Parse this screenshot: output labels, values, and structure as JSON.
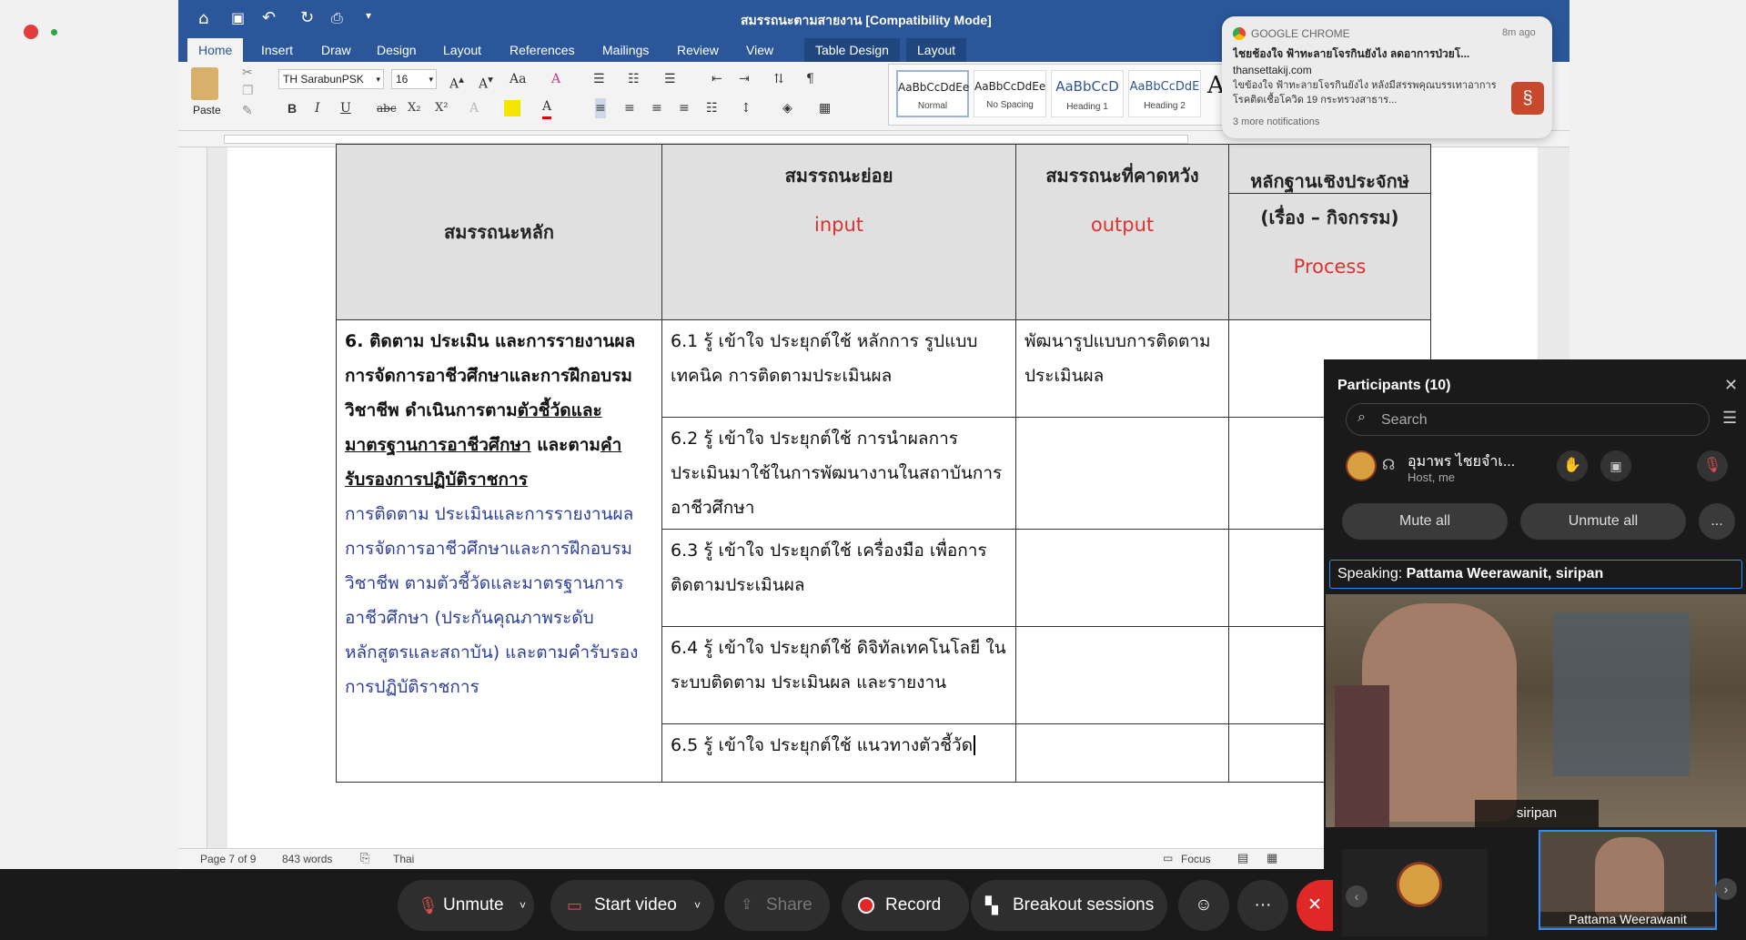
{
  "window": {
    "title": "สมรรถนะตามสายงาน [Compatibility Mode]"
  },
  "ribbon": {
    "tabs": [
      "Home",
      "Insert",
      "Draw",
      "Design",
      "Layout",
      "References",
      "Mailings",
      "Review",
      "View",
      "Table Design",
      "Layout"
    ],
    "active_tab": "Home",
    "font_name": "TH SarabunPSK",
    "font_size": "16",
    "paste_label": "Paste",
    "styles": [
      {
        "preview": "AaBbCcDdEe",
        "name": "Normal"
      },
      {
        "preview": "AaBbCcDdEe",
        "name": "No Spacing"
      },
      {
        "preview": "AaBbCcD",
        "name": "Heading 1"
      },
      {
        "preview": "AaBbCcDdE",
        "name": "Heading 2"
      }
    ]
  },
  "document": {
    "header": {
      "col1": "สมรรถนะหลัก",
      "col2": "สมรรถนะย่อย",
      "col2_sub": "input",
      "col3": "สมรรถนะที่คาดหวัง",
      "col3_sub": "output",
      "col4_top": "หลักฐานเชิงประจักษ์",
      "col4": "(เรื่อง – กิจกรรม)",
      "col4_sub": "Process"
    },
    "main_competency": {
      "num": "6. ",
      "p1": "ติดตาม ประเมิน และการรายงานผลการจัดการอาชีวศึกษาและการฝึกอบรมวิชาชีพ ดำเนินการตาม",
      "u1": "ตัวชี้วัดและมาตรฐานการอาชีวศึกษา",
      "p2": " และตาม",
      "u2": "คำรับรองการปฏิบัติราชการ",
      "desc": "การติดตาม ประเมินและการรายงานผลการจัดการอาชีวศึกษาและการฝึกอบรมวิชาชีพ ตามตัวชี้วัดและมาตรฐานการอาชีวศึกษา (ประกันคุณภาพระดับหลักสูตรและสถาบัน) และตามคำรับรองการปฏิบัติราชการ"
    },
    "rows": [
      {
        "sub": "6.1 รู้ เข้าใจ ประยุกต์ใช้ หลักการ รูปแบบ เทคนิค การติดตามประเมินผล",
        "output": "พัฒนารูปแบบการติดตามประเมินผล"
      },
      {
        "sub": "6.2 รู้ เข้าใจ ประยุกต์ใช้ การนำผลการประเมินมาใช้ในการพัฒนางานในสถาบันการอาชีวศึกษา",
        "output": ""
      },
      {
        "sub": "6.3 รู้ เข้าใจ ประยุกต์ใช้ เครื่องมือ เพื่อการติดตามประเมินผล",
        "output": ""
      },
      {
        "sub": "6.4 รู้ เข้าใจ ประยุกต์ใช้ ดิจิทัลเทคโนโลยี ในระบบติดตาม ประเมินผล และรายงาน",
        "output": ""
      },
      {
        "sub": "6.5 รู้ เข้าใจ ประยุกต์ใช้ แนวทางตัวชี้วัด",
        "output": ""
      }
    ]
  },
  "statusbar": {
    "page": "Page 7 of 9",
    "words": "843 words",
    "language": "Thai",
    "focus": "Focus"
  },
  "notification": {
    "app": "GOOGLE CHROME",
    "time": "8m ago",
    "title": "ไชยช้องใจ ฟ้าทะลายโจรกินยังไง ลดอาการป่วยโ...",
    "site": "thansettakij.com",
    "body": "ไขข้องใจ ฟ้าทะลายโจรกินยังไง หลังมีสรรพคุณบรรเทาอาการโรคติดเชื้อโควิด 19 กระทรวงสาธาร...",
    "more": "3 more notifications"
  },
  "participants": {
    "title": "Participants (10)",
    "search_placeholder": "Search",
    "host_name": "อุมาพร ไชยจำเ...",
    "host_role": "Host, me",
    "mute_all": "Mute all",
    "unmute_all": "Unmute all",
    "more": "..."
  },
  "speaking": {
    "label": "Speaking: ",
    "names": "Pattama Weerawanit, siripan"
  },
  "video": {
    "main_name": "siripan",
    "thumb_name": "Pattama Weerawanit"
  },
  "toolbar": {
    "unmute": "Unmute",
    "start_video": "Start video",
    "share": "Share",
    "record": "Record",
    "breakout": "Breakout sessions",
    "more": "···"
  },
  "colors": {
    "word_blue": "#2b579a",
    "red_text": "#e03030",
    "blue_text": "#2c3e9f",
    "zoom_dark": "#1a1a1a",
    "record_red": "#e02828"
  }
}
